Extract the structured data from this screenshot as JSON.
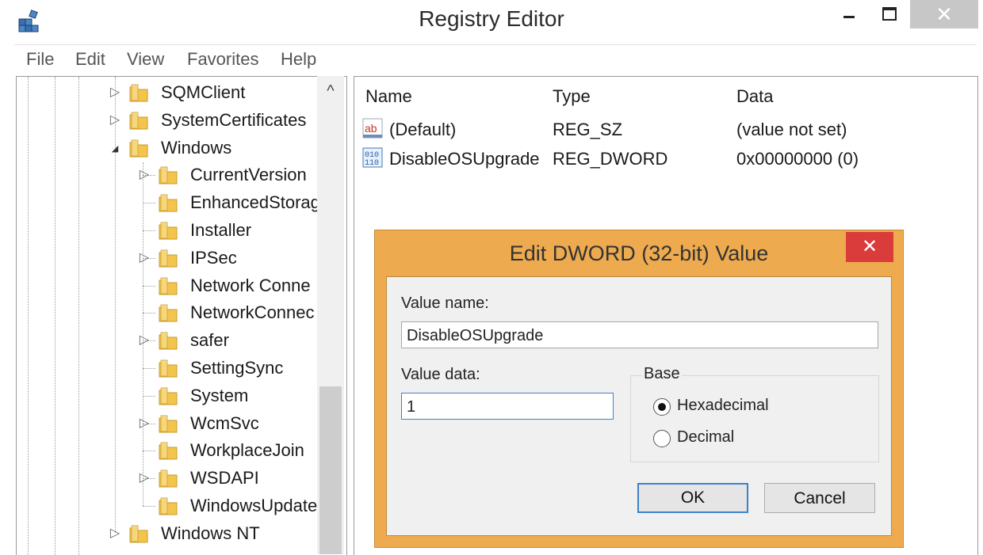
{
  "window": {
    "title": "Registry Editor",
    "close_glyph": "✕"
  },
  "menu": [
    "File",
    "Edit",
    "View",
    "Favorites",
    "Help"
  ],
  "tree": {
    "scroll_up_glyph": "^",
    "items": [
      {
        "label": "SQMClient",
        "expander": "▷",
        "level": 1
      },
      {
        "label": "SystemCertificates",
        "expander": "▷",
        "level": 1
      },
      {
        "label": "Windows",
        "expander": "◢",
        "level": 1
      },
      {
        "label": "CurrentVersion",
        "expander": "▷",
        "level": 2
      },
      {
        "label": "EnhancedStorag",
        "expander": "",
        "level": 2
      },
      {
        "label": "Installer",
        "expander": "",
        "level": 2
      },
      {
        "label": "IPSec",
        "expander": "▷",
        "level": 2
      },
      {
        "label": "Network Conne",
        "expander": "",
        "level": 2
      },
      {
        "label": "NetworkConnec",
        "expander": "",
        "level": 2
      },
      {
        "label": "safer",
        "expander": "▷",
        "level": 2
      },
      {
        "label": "SettingSync",
        "expander": "",
        "level": 2
      },
      {
        "label": "System",
        "expander": "",
        "level": 2
      },
      {
        "label": "WcmSvc",
        "expander": "▷",
        "level": 2
      },
      {
        "label": "WorkplaceJoin",
        "expander": "",
        "level": 2
      },
      {
        "label": "WSDAPI",
        "expander": "▷",
        "level": 2
      },
      {
        "label": "WindowsUpdate",
        "expander": "",
        "level": 2
      },
      {
        "label": "Windows NT",
        "expander": "▷",
        "level": 1
      }
    ]
  },
  "list": {
    "columns": {
      "name": "Name",
      "type": "Type",
      "data": "Data"
    },
    "rows": [
      {
        "icon": "string-value-icon",
        "name": "(Default)",
        "type": "REG_SZ",
        "data": "(value not set)"
      },
      {
        "icon": "binary-value-icon",
        "name": "DisableOSUpgrade",
        "type": "REG_DWORD",
        "data": "0x00000000 (0)"
      }
    ]
  },
  "dialog": {
    "title": "Edit DWORD (32-bit) Value",
    "close_glyph": "✕",
    "value_name_label": "Value name:",
    "value_name": "DisableOSUpgrade",
    "value_data_label": "Value data:",
    "value_data": "1",
    "base_label": "Base",
    "base_options": [
      {
        "label": "Hexadecimal",
        "selected": true
      },
      {
        "label": "Decimal",
        "selected": false
      }
    ],
    "ok_label": "OK",
    "cancel_label": "Cancel"
  },
  "colors": {
    "dialog_frame": "#eeaa4e",
    "close_red": "#d93c3a",
    "focus_blue": "#3c82c9",
    "folder_yellow": "#f3c54d"
  }
}
